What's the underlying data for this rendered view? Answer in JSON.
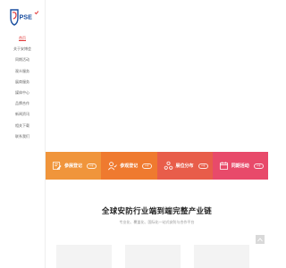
{
  "brand": {
    "logo_text": "PSE"
  },
  "sidebar": {
    "items": [
      {
        "label": "首页",
        "active": true
      },
      {
        "label": "关于安博会",
        "active": false
      },
      {
        "label": "同期活动",
        "active": false
      },
      {
        "label": "观众服务",
        "active": false
      },
      {
        "label": "展商服务",
        "active": false
      },
      {
        "label": "媒体中心",
        "active": false
      },
      {
        "label": "品牌合作",
        "active": false
      },
      {
        "label": "新闻资讯",
        "active": false
      },
      {
        "label": "相关下载",
        "active": false
      },
      {
        "label": "联系我们",
        "active": false
      }
    ]
  },
  "cards": [
    {
      "label": "参展登记",
      "color": "#f0953b",
      "icon": "edit-icon"
    },
    {
      "label": "参观登记",
      "color": "#ef7a2f",
      "icon": "visitor-icon"
    },
    {
      "label": "展位分布",
      "color": "#e85d4a",
      "icon": "layout-icon"
    },
    {
      "label": "同期活动",
      "color": "#e84a6a",
      "icon": "activity-icon"
    }
  ],
  "section": {
    "title": "全球安防行业端到端完整产业链",
    "subtitle": "专业化、覆盖化、国际化一站式安防与合作平台"
  },
  "colors": {
    "accent": "#e23b3b",
    "logo_blue": "#1a4fa0"
  }
}
